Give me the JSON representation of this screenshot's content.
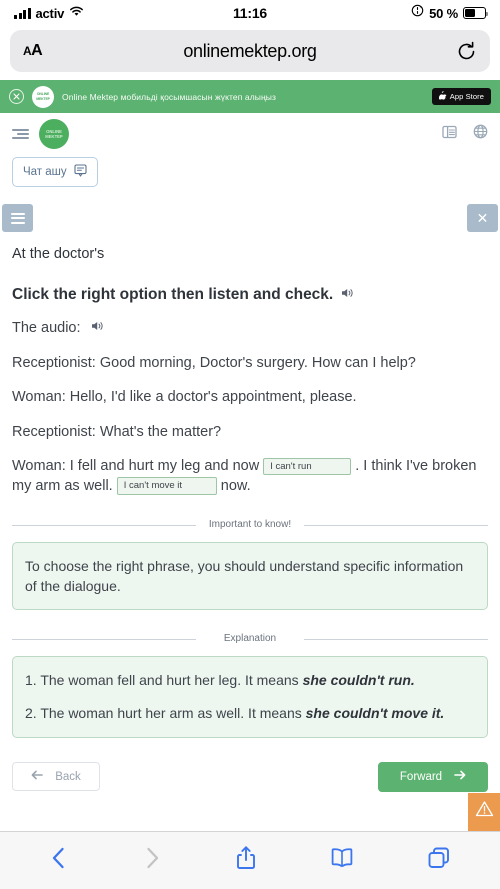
{
  "status_bar": {
    "carrier": "activ",
    "time": "11:16",
    "battery_percent": "50 %",
    "signal_icon": "cellular-bars-icon",
    "wifi_icon": "wifi-icon",
    "rotation_lock_icon": "rotation-lock-icon",
    "battery_icon": "battery-icon"
  },
  "browser": {
    "text_size_label": "AA",
    "url": "onlinemektep.org",
    "reload_icon": "reload-icon",
    "bottom_toolbar": [
      {
        "name": "back",
        "icon": "chevron-left-icon",
        "enabled": true
      },
      {
        "name": "forward",
        "icon": "chevron-right-icon",
        "enabled": false
      },
      {
        "name": "share",
        "icon": "share-icon",
        "enabled": true
      },
      {
        "name": "bookmarks",
        "icon": "book-icon",
        "enabled": true
      },
      {
        "name": "tabs",
        "icon": "tabs-icon",
        "enabled": true
      }
    ]
  },
  "app_banner": {
    "close_icon": "close-icon",
    "logo_line1": "ONLINE",
    "logo_line2": "MEKTEP",
    "text": "Online Mektep мобильді қосымшасын жүктеп алыңыз",
    "store_button": "App Store",
    "apple_icon": "apple-icon",
    "background": "#5cb270"
  },
  "site_header": {
    "menu_icon": "menu-list-icon",
    "logo_line1": "ONLINE",
    "logo_line2": "MEKTEP",
    "grid_icon": "layout-icon",
    "language_icon": "globe-icon"
  },
  "chat": {
    "label": "Чат ашу",
    "icon": "chat-bubble-icon"
  },
  "task_bar": {
    "menu_icon": "hamburger-icon",
    "close_icon": "close-icon"
  },
  "lesson": {
    "title": "At the doctor's",
    "task_instruction": "Click the right option then listen and check.",
    "task_audio_icon": "speaker-icon",
    "audio_label": "The audio:",
    "audio_icon": "speaker-icon",
    "dialogue": [
      "Receptionist: Good morning, Doctor's surgery. How can I help?",
      "Woman: Hello, I'd like a doctor's appointment, please.",
      "Receptionist: What's the matter?"
    ],
    "answer_line": {
      "part1": "Woman: I fell and hurt my leg and now",
      "blank1": "I can't run",
      "part2": ". I think I've broken my arm as well.",
      "blank2": "I can't move it",
      "part3": "now."
    }
  },
  "important": {
    "caption": "Important to know!",
    "text": "To choose the right phrase, you should understand specific information of the dialogue."
  },
  "explanation": {
    "caption": "Explanation",
    "items": [
      {
        "prefix": "1. The woman fell and hurt her leg. It means ",
        "emphasis": "she couldn't run."
      },
      {
        "prefix": "2. The woman hurt her arm as well. It means ",
        "emphasis": "she couldn't move it."
      }
    ]
  },
  "navigation": {
    "back_label": "Back",
    "back_icon": "arrow-left-icon",
    "forward_label": "Forward",
    "forward_icon": "arrow-right-icon",
    "forward_color": "#5cb270",
    "warning_icon": "warning-triangle-icon",
    "warning_color": "#eb9a4e"
  }
}
